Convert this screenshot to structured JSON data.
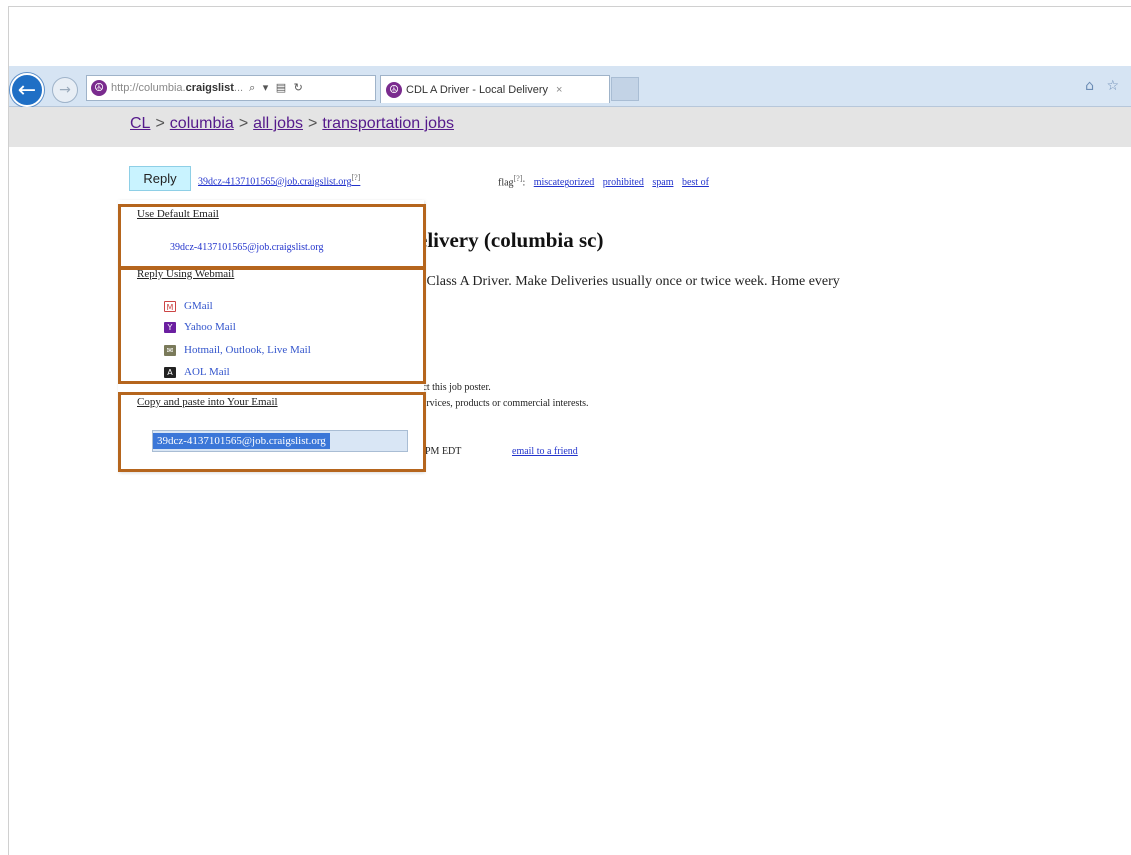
{
  "browser": {
    "address_url_prefix": "http://columbia.",
    "address_url_domain": "craigslist",
    "address_url_suffix": "...",
    "address_tools": "⌕ ▾ ▤ ↻",
    "tab_title": "CDL A Driver - Local Delivery",
    "tab_close": "×",
    "right_icons": "⌂ ☆"
  },
  "breadcrumbs": {
    "cl": "CL",
    "separator": ">",
    "columbia": "columbia",
    "all_jobs": "all jobs",
    "transportation_jobs": "transportation jobs"
  },
  "posting_header": {
    "reply_label": "Reply",
    "reply_email": "39dcz-4137101565@job.craigslist.org",
    "reply_email_sup": "[?]",
    "flag_label": "flag",
    "flag_sup": "[?]",
    "flag_colon": ":",
    "flag_links": [
      "miscategorized",
      "prohibited",
      "spam",
      "best of"
    ]
  },
  "reply_popup": {
    "use_default_title": "Use Default Email",
    "default_email": "39dcz-4137101565@job.craigslist.org",
    "webmail_title": "Reply Using Webmail",
    "webmail_options": [
      {
        "label": "GMail",
        "icon": "gmail-icon",
        "glyph": "M"
      },
      {
        "label": "Yahoo Mail",
        "icon": "yahoo-icon",
        "glyph": "Y"
      },
      {
        "label": "Hotmail, Outlook, Live Mail",
        "icon": "hotmail-icon",
        "glyph": "✉"
      },
      {
        "label": "AOL Mail",
        "icon": "aol-icon",
        "glyph": "A"
      }
    ],
    "copy_title": "Copy and paste into Your Email",
    "copy_value": "39dcz-4137101565@job.craigslist.org"
  },
  "posting": {
    "title_visible": "elivery (columbia sc)",
    "body_visible": "L Class A Driver. Make Deliveries usually once or twice week. Home every",
    "contact_note": "act this job poster.",
    "services_note": "services, products or commercial interests.",
    "posted_time": "PM EDT",
    "email_friend": "email to a friend"
  },
  "colors": {
    "highlight_box": "#b5651d",
    "link": "#2233cc",
    "visited_link": "#551a8b",
    "reply_button_bg": "#c9f3ff"
  }
}
